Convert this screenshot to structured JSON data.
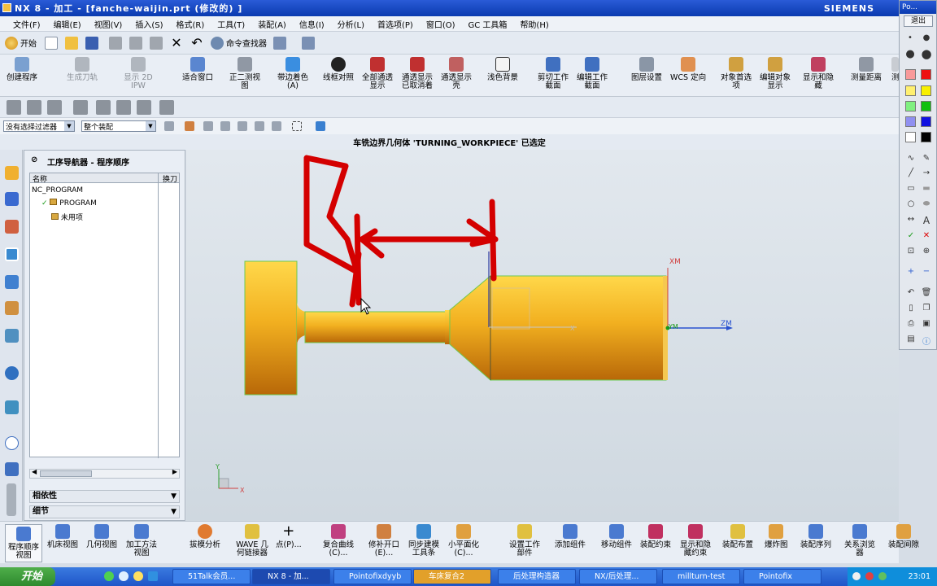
{
  "title_bar": {
    "title": "NX 8 - 加工 - [fanche-waijin.prt  (修改的)  ]",
    "brand": "SIEMENS"
  },
  "menu": [
    "文件(F)",
    "编辑(E)",
    "视图(V)",
    "插入(S)",
    "格式(R)",
    "工具(T)",
    "装配(A)",
    "信息(I)",
    "分析(L)",
    "首选项(P)",
    "窗口(O)",
    "GC 工具箱",
    "帮助(H)"
  ],
  "std_toolbar": {
    "start": "开始",
    "finder": "命令查找器"
  },
  "big_toolbar": [
    "创建程序",
    "生成刀轨",
    "显示 2D IPW",
    "适合窗口",
    "正二测视图",
    "带边着色(A)",
    "线框对照",
    "全部通透显示",
    "通透显示已取消着",
    "通透显示壳",
    "浅色背景",
    "剪切工作截面",
    "编辑工作截面",
    "图层设置",
    "WCS 定向",
    "对象首选项",
    "编辑对象显示",
    "显示和隐藏",
    "测量距离",
    "测"
  ],
  "filter": {
    "selection_filter": "没有选择过滤器",
    "scope": "整个装配"
  },
  "status_message": "车铣边界几何体 'TURNING_WORKPIECE' 已选定",
  "navigator": {
    "title": "工序导航器 - 程序顺序",
    "col_name": "名称",
    "col_tool": "换刀",
    "rows": [
      "NC_PROGRAM",
      "PROGRAM",
      "未用项"
    ],
    "dependencies": "相依性",
    "details": "细节"
  },
  "viewport": {
    "axis_xm": "XM",
    "axis_ym": "YM",
    "axis_zm": "ZM",
    "axis_x": "X",
    "axis_y": "Y",
    "axis_x2": "X"
  },
  "bottom_toolbar": [
    "程序顺序视图",
    "机床视图",
    "几何视图",
    "加工方法视图",
    "拔模分析",
    "WAVE 几何链接器",
    "点(P)...",
    "复合曲线(C)...",
    "修补开口(E)...",
    "同步建模工具条",
    "小平面化(C)...",
    "设置工作部件",
    "添加组件",
    "移动组件",
    "装配约束",
    "显示和隐藏约束",
    "装配布置",
    "爆炸图",
    "装配序列",
    "关系浏览器",
    "装配间隙"
  ],
  "taskbar": {
    "start": "开始",
    "tasks": [
      "51Talk会员...",
      "NX 8 - 加...",
      "Pointofixdyyb",
      "车床复合2",
      "后处理构造器",
      "NX/后处理...",
      "millturn-test",
      "Pointofix"
    ],
    "clock": "23:01"
  },
  "draw_panel": {
    "title": "Po...",
    "exit": "退出",
    "text_tool": "A"
  },
  "colors": {
    "titlebar": "#0a3bb0",
    "part": "#e8a317",
    "annotation": "#dd0000"
  }
}
